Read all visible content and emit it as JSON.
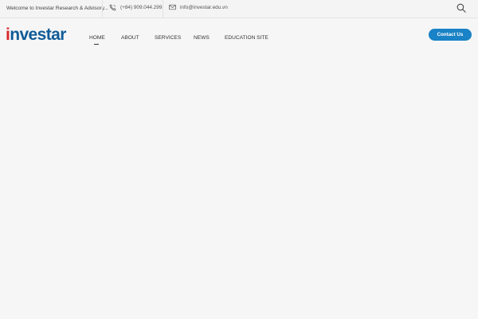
{
  "topbar": {
    "welcome_text": "Welcome to Investar Research & Advisory...",
    "phone": "(+84) 909.044.299",
    "email": "info@investar.edu.vn",
    "icons": {
      "phone": "phone-icon",
      "email": "mail-icon",
      "search": "search-icon"
    }
  },
  "brand": {
    "logo_first": "i",
    "logo_rest": "nvestar",
    "colors": {
      "red": "#d8272e",
      "blue": "#0f5b97"
    }
  },
  "nav": {
    "items": [
      {
        "label": "HOME",
        "active": true
      },
      {
        "label": "ABOUT",
        "active": false
      },
      {
        "label": "SERVICES",
        "active": false
      },
      {
        "label": "NEWS",
        "active": false
      },
      {
        "label": "EDUCATION SITE",
        "active": false
      }
    ]
  },
  "cta": {
    "label": "Contact Us",
    "color": "#1a82c6"
  }
}
